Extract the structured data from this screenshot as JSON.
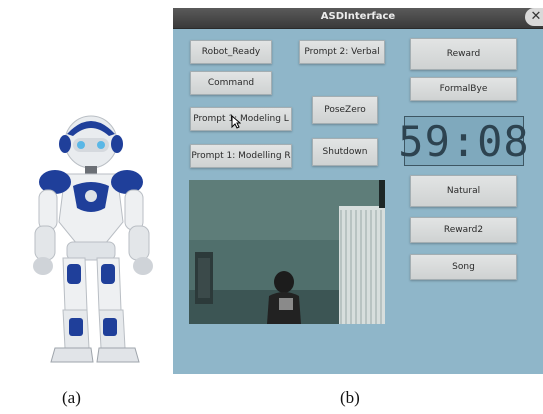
{
  "captions": {
    "a": "(a)",
    "b": "(b)"
  },
  "window": {
    "title": "ASDInterface",
    "close_glyph": "✕"
  },
  "buttons": {
    "robot_ready": "Robot_Ready",
    "command": "Command",
    "prompt2_verbal": "Prompt 2: Verbal",
    "prompt1_modeling_l": "Prompt 1: Modeling L",
    "pose_zero": "PoseZero",
    "prompt1_modelling_r": "Prompt 1: Modelling R",
    "shutdown": "Shutdown",
    "reward": "Reward",
    "formal_bye": "FormalBye",
    "natural": "Natural",
    "reward2": "Reward2",
    "song": "Song"
  },
  "timer": {
    "display": "59:08"
  },
  "icons": {
    "close": "close-icon",
    "cursor": "mouse-pointer-icon"
  },
  "colors": {
    "window_bg": "#8fb6c9",
    "titlebar": "#3f3f3f",
    "button": "#d8dbdb",
    "lcd_digits": "#2d4350",
    "robot_blue": "#1f3f9a"
  }
}
